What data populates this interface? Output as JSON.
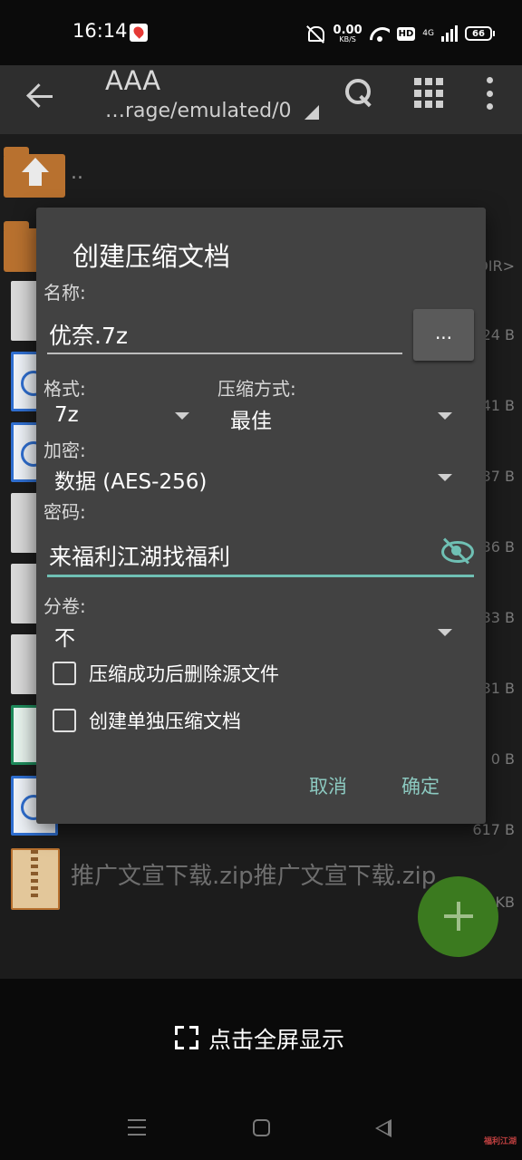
{
  "status_bar": {
    "time": "16:14",
    "net_speed_value": "0.00",
    "net_speed_unit": "KB/S",
    "hd": "HD",
    "network_type": "4G",
    "battery": "66"
  },
  "toolbar": {
    "title": "AAA",
    "path": "…rage/emulated/0"
  },
  "file_list": {
    "parent_dir": "..",
    "dir_tag": "DIR>",
    "sizes": [
      "24 B",
      "41 B",
      "37 B",
      "36 B",
      "33 B",
      "31 B",
      "0 B",
      "617 B",
      "KB"
    ],
    "zip_name": "推广文宣下载.zip推广文宣下载.zip"
  },
  "dialog": {
    "title": "创建压缩文档",
    "name_label": "名称:",
    "name_value": "优奈.7z",
    "browse_label": "...",
    "format_label": "格式:",
    "format_value": "7z",
    "method_label": "压缩方式:",
    "method_value": "最佳",
    "encryption_label": "加密:",
    "encryption_value": "数据 (AES-256)",
    "password_label": "密码:",
    "password_value": "来福利江湖找福利",
    "volume_label": "分卷:",
    "volume_value": "不",
    "checkbox_delete_source": "压缩成功后删除源文件",
    "checkbox_separate_archive": "创建单独压缩文档",
    "cancel_label": "取消",
    "ok_label": "确定"
  },
  "fullscreen_bar": {
    "label": "点击全屏显示"
  },
  "watermark": "福利江湖",
  "colors": {
    "accent": "#6fc0b4",
    "dialog_bg": "#424242",
    "toolbar_bg": "#2e2e2e",
    "fab": "#3b7a1f",
    "folder": "#b8712f"
  }
}
